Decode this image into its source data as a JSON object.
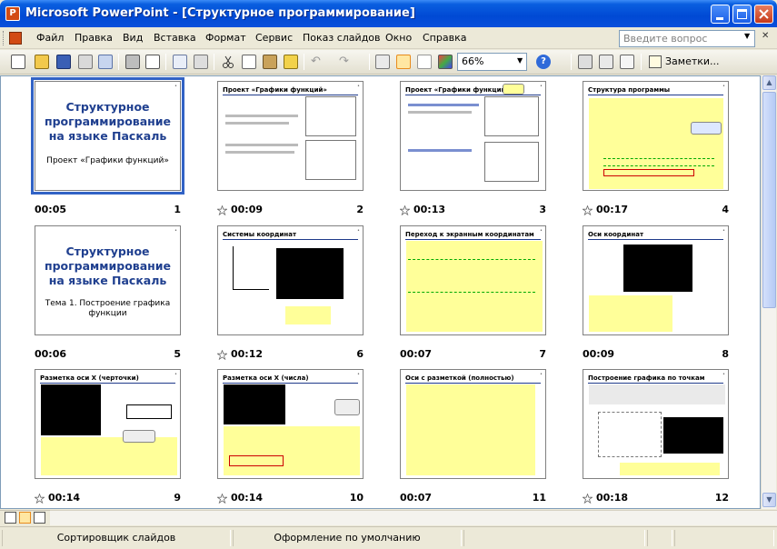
{
  "window": {
    "title": "Microsoft PowerPoint - [Структурное программирование]"
  },
  "menu": {
    "items": [
      "Файл",
      "Правка",
      "Вид",
      "Вставка",
      "Формат",
      "Сервис",
      "Показ слайдов",
      "Окно",
      "Справка"
    ],
    "help_placeholder": "Введите вопрос"
  },
  "toolbar": {
    "zoom": "66%",
    "notes_label": "Заметки..."
  },
  "slides": [
    {
      "num": "1",
      "time": "00:05",
      "kind": "title",
      "title": "Структурное программирование на языке Паскаль",
      "subtitle": "Проект «Графики функций»",
      "selected": true,
      "star": false
    },
    {
      "num": "2",
      "time": "00:09",
      "kind": "content",
      "title": "Проект «Графики функций»",
      "star": true
    },
    {
      "num": "3",
      "time": "00:13",
      "kind": "content",
      "title": "Проект «Графики функций»",
      "star": true
    },
    {
      "num": "4",
      "time": "00:17",
      "kind": "content",
      "title": "Структура программы",
      "star": true
    },
    {
      "num": "5",
      "time": "00:06",
      "kind": "title",
      "title": "Структурное программирование на языке Паскаль",
      "subtitle": "Тема 1. Построение графика функции",
      "star": false
    },
    {
      "num": "6",
      "time": "00:12",
      "kind": "content",
      "title": "Системы координат",
      "star": true
    },
    {
      "num": "7",
      "time": "00:07",
      "kind": "content",
      "title": "Переход к экранным координатам",
      "star": false
    },
    {
      "num": "8",
      "time": "00:09",
      "kind": "content",
      "title": "Оси координат",
      "star": false
    },
    {
      "num": "9",
      "time": "00:14",
      "kind": "content",
      "title": "Разметка оси X (черточки)",
      "star": true
    },
    {
      "num": "10",
      "time": "00:14",
      "kind": "content",
      "title": "Разметка оси X (числа)",
      "star": true
    },
    {
      "num": "11",
      "time": "00:07",
      "kind": "content",
      "title": "Оси с разметкой (полностью)",
      "star": false
    },
    {
      "num": "12",
      "time": "00:18",
      "kind": "content",
      "title": "Построение графика по точкам",
      "star": true
    }
  ],
  "status": {
    "view": "Сортировщик слайдов",
    "design": "Оформление по умолчанию"
  },
  "colors": {
    "titlebar": "#0a5fe0",
    "selection": "#3162c5",
    "slide_title": "#1f3f8f",
    "yellow": "#ffff99"
  }
}
